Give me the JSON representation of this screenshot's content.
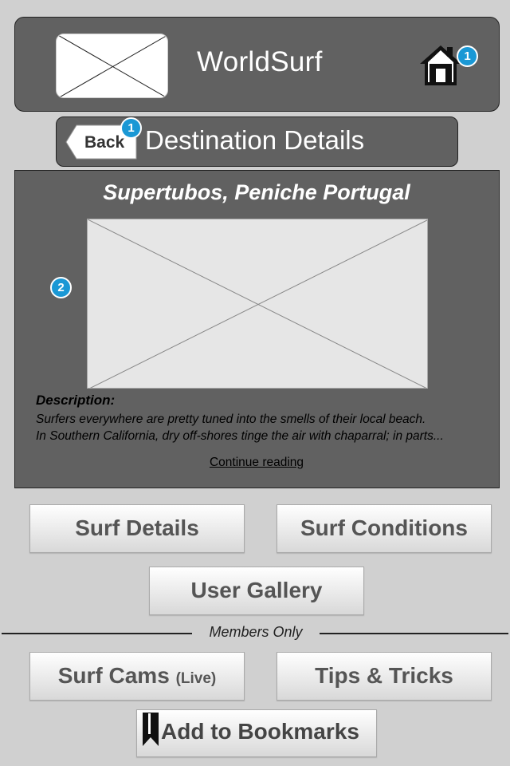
{
  "header": {
    "app_title": "WorldSurf",
    "home_badge": "1",
    "logo_icon": "image-placeholder-icon",
    "home_icon": "home-icon"
  },
  "subheader": {
    "back_label": "Back",
    "back_badge": "1",
    "title": "Destination Details"
  },
  "destination": {
    "title": "Supertubos, Peniche Portugal",
    "image_badge": "2",
    "description_heading": "Description:",
    "description_line1": "Surfers everywhere are pretty tuned into the smells of their local beach.",
    "description_line2": "In Southern California, dry off-shores tinge the air with chaparral; in parts...",
    "continue_label": "Continue reading"
  },
  "buttons": {
    "surf_details": "Surf Details",
    "surf_conditions": "Surf Conditions",
    "user_gallery": "User Gallery",
    "surf_cams": "Surf Cams",
    "surf_cams_live": "(Live)",
    "tips_tricks": "Tips & Tricks",
    "add_bookmarks": "Add to Bookmarks"
  },
  "members": {
    "label": "Members Only"
  },
  "colors": {
    "panel": "#616161",
    "badge": "#1a98d5",
    "background": "#d0d0d0"
  }
}
